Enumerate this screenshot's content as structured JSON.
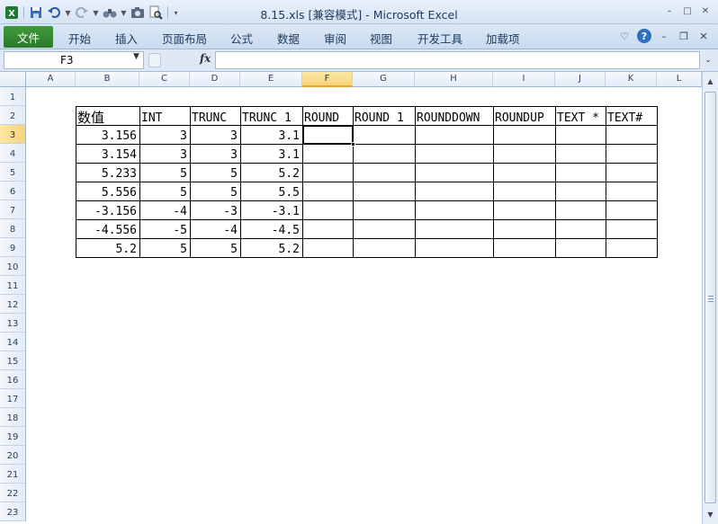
{
  "window": {
    "title": "8.15.xls  [兼容模式]  -  Microsoft Excel",
    "controls": [
      "–",
      "□",
      "✕"
    ]
  },
  "ribbon": {
    "file_tab": "文件",
    "tabs": [
      "开始",
      "插入",
      "页面布局",
      "公式",
      "数据",
      "审阅",
      "视图",
      "开发工具",
      "加载项"
    ]
  },
  "formula_bar": {
    "name_box": "F3",
    "fx_label": "fx",
    "content": ""
  },
  "sheet": {
    "columns": [
      "A",
      "B",
      "C",
      "D",
      "E",
      "F",
      "G",
      "H",
      "I",
      "J",
      "K",
      "L"
    ],
    "rows": [
      "1",
      "2",
      "3",
      "4",
      "5",
      "6",
      "7",
      "8",
      "9",
      "10",
      "11",
      "12",
      "13",
      "14",
      "15",
      "16",
      "17",
      "18",
      "19",
      "20",
      "21",
      "22",
      "23"
    ],
    "selected_cell": "F3",
    "table_headers": [
      "数值",
      "INT",
      "TRUNC",
      "TRUNC 1",
      "ROUND",
      "ROUND 1",
      "ROUNDDOWN",
      "ROUNDUP",
      "TEXT *",
      "TEXT#"
    ],
    "table_rows": [
      [
        "3.156",
        "3",
        "3",
        "3.1"
      ],
      [
        "3.154",
        "3",
        "3",
        "3.1"
      ],
      [
        "5.233",
        "5",
        "5",
        "5.2"
      ],
      [
        "5.556",
        "5",
        "5",
        "5.5"
      ],
      [
        "-3.156",
        "-4",
        "-3",
        "-3.1"
      ],
      [
        "-4.556",
        "-5",
        "-4",
        "-4.5"
      ],
      [
        "5.2",
        "5",
        "5",
        "5.2"
      ]
    ]
  },
  "colors": {
    "file_tab": "#2b7a2a",
    "selected_header": "#f8d27a",
    "grid_border": "#000000"
  }
}
